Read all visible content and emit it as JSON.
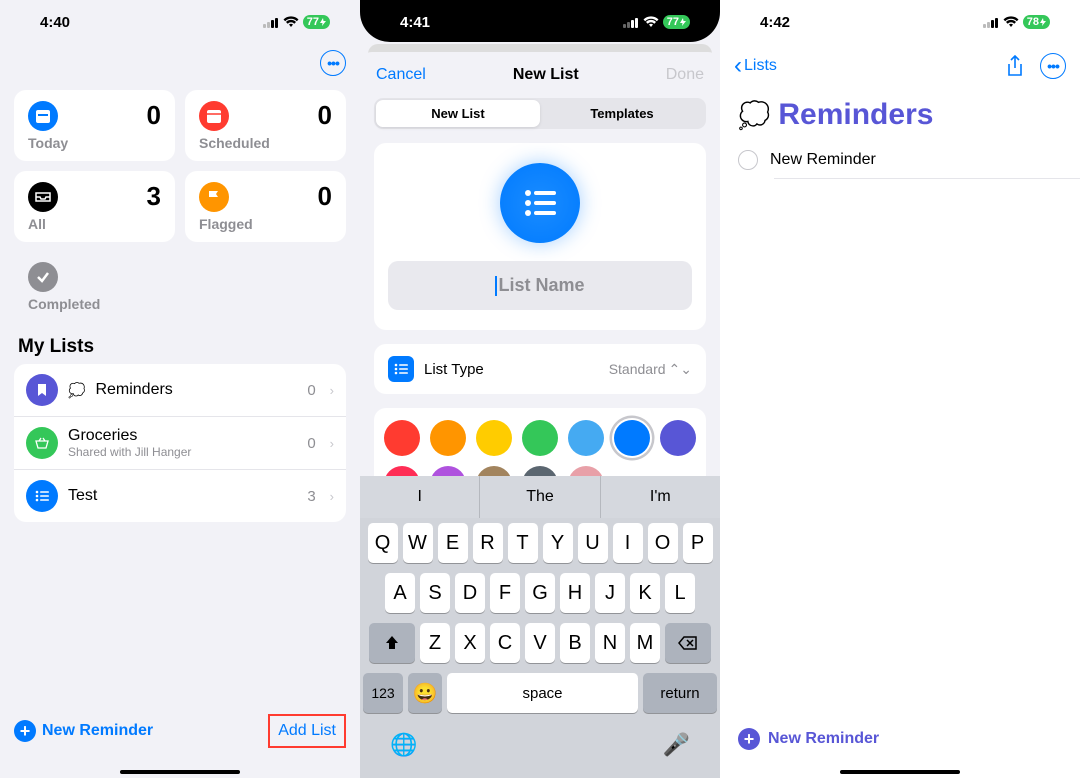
{
  "screen1": {
    "time": "4:40",
    "battery": "77",
    "cards": {
      "today": {
        "label": "Today",
        "count": "0",
        "color": "#007aff"
      },
      "scheduled": {
        "label": "Scheduled",
        "count": "0",
        "color": "#ff3b30"
      },
      "all": {
        "label": "All",
        "count": "3",
        "color": "#000000"
      },
      "flagged": {
        "label": "Flagged",
        "count": "0",
        "color": "#ff9500"
      },
      "completed": {
        "label": "Completed"
      }
    },
    "my_lists_heading": "My Lists",
    "lists": [
      {
        "name": "Reminders",
        "sub": "",
        "count": "0",
        "color": "#5856d6",
        "emoji": "💭"
      },
      {
        "name": "Groceries",
        "sub": "Shared with Jill Hanger",
        "count": "0",
        "color": "#34c759"
      },
      {
        "name": "Test",
        "sub": "",
        "count": "3",
        "color": "#007aff"
      }
    ],
    "new_reminder": "New Reminder",
    "add_list": "Add List"
  },
  "screen2": {
    "time": "4:41",
    "battery": "77",
    "nav": {
      "cancel": "Cancel",
      "title": "New List",
      "done": "Done"
    },
    "seg": {
      "newlist": "New List",
      "templates": "Templates"
    },
    "placeholder": "List Name",
    "list_type": {
      "label": "List Type",
      "value": "Standard"
    },
    "colors_row1": [
      "#ff3b30",
      "#ff9500",
      "#ffcc00",
      "#34c759",
      "#45aaf2",
      "#007aff",
      "#5856d6"
    ],
    "colors_row2": [
      "#ff2d55",
      "#af52de",
      "#a2845e",
      "#5b6670",
      "#e8a0a8"
    ],
    "selected_color_index": 5,
    "suggestions": [
      "I",
      "The",
      "I'm"
    ],
    "keyboard": {
      "row1": [
        "Q",
        "W",
        "E",
        "R",
        "T",
        "Y",
        "U",
        "I",
        "O",
        "P"
      ],
      "row2": [
        "A",
        "S",
        "D",
        "F",
        "G",
        "H",
        "J",
        "K",
        "L"
      ],
      "row3": [
        "Z",
        "X",
        "C",
        "V",
        "B",
        "N",
        "M"
      ],
      "num": "123",
      "space": "space",
      "return": "return"
    }
  },
  "screen3": {
    "time": "4:42",
    "battery": "78",
    "back": "Lists",
    "title": "Reminders",
    "emoji": "💭",
    "item": "New Reminder",
    "new_reminder": "New Reminder",
    "accent": "#5856d6"
  }
}
